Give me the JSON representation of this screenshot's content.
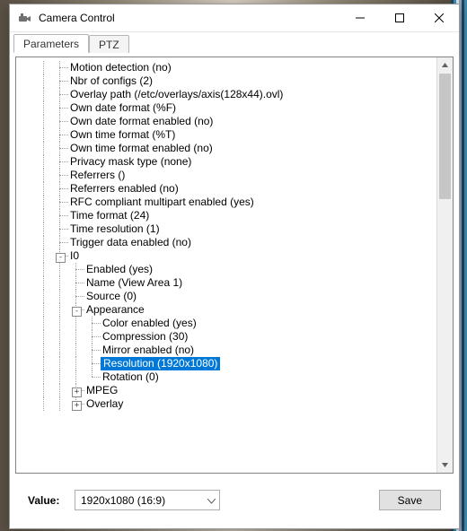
{
  "window": {
    "title": "Camera Control"
  },
  "tabs": {
    "parameters": "Parameters",
    "ptz": "PTZ"
  },
  "tree": {
    "motion_detection": "Motion detection (no)",
    "nbr_of_configs": "Nbr of configs (2)",
    "overlay_path": "Overlay path (/etc/overlays/axis(128x44).ovl)",
    "own_date_format": "Own date format (%F)",
    "own_date_format_enabled": "Own date format enabled (no)",
    "own_time_format": "Own time format (%T)",
    "own_time_format_enabled": "Own time format enabled (no)",
    "privacy_mask_type": "Privacy mask type (none)",
    "referrers": "Referrers ()",
    "referrers_enabled": "Referrers enabled (no)",
    "rfc_multipart": "RFC compliant multipart enabled (yes)",
    "time_format": "Time format (24)",
    "time_resolution": "Time resolution (1)",
    "trigger_data_enabled": "Trigger data enabled (no)",
    "i0": "I0",
    "i0_enabled": "Enabled (yes)",
    "i0_name": "Name (View Area 1)",
    "i0_source": "Source (0)",
    "appearance": "Appearance",
    "color_enabled": "Color enabled (yes)",
    "compression": "Compression (30)",
    "mirror_enabled": "Mirror enabled (no)",
    "resolution": "Resolution (1920x1080)",
    "rotation": "Rotation (0)",
    "mpeg": "MPEG",
    "overlay": "Overlay"
  },
  "value": {
    "label": "Value:",
    "selected": "1920x1080 (16:9)"
  },
  "buttons": {
    "save": "Save"
  }
}
